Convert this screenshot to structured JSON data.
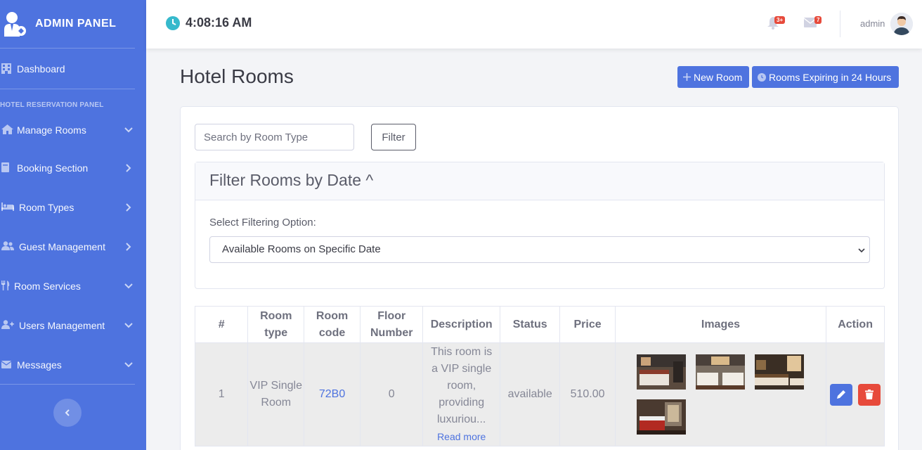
{
  "brand": {
    "title": "ADMIN PANEL"
  },
  "sidebar": {
    "dashboard": "Dashboard",
    "heading": "HOTEL RESERVATION PANEL",
    "items": [
      {
        "label": "Manage Rooms",
        "chevron": "down"
      },
      {
        "label": "Booking Section",
        "chevron": "right"
      },
      {
        "label": "Room Types",
        "chevron": "right"
      },
      {
        "label": "Guest Management",
        "chevron": "right"
      },
      {
        "label": "Room Services",
        "chevron": "down"
      },
      {
        "label": "Users Management",
        "chevron": "down"
      },
      {
        "label": "Messages",
        "chevron": "down"
      }
    ]
  },
  "topbar": {
    "time": "4:08:16 AM",
    "alerts_badge": "3+",
    "messages_badge": "7",
    "user": "admin"
  },
  "page": {
    "title": "Hotel Rooms",
    "new_room": "New Room",
    "expiring": "Rooms Expiring in 24 Hours"
  },
  "search": {
    "placeholder": "Search by Room Type",
    "filter_button": "Filter"
  },
  "date_filter": {
    "title": "Filter Rooms by Date ^",
    "label": "Select Filtering Option:",
    "selected": "Available Rooms on Specific Date"
  },
  "table": {
    "headers": [
      "#",
      "Room type",
      "Room code",
      "Floor Number",
      "Description",
      "Status",
      "Price",
      "Images",
      "Action"
    ],
    "rows": [
      {
        "num": "1",
        "type": "VIP Single Room",
        "code": "72B0",
        "floor": "0",
        "description": "This room is a VIP single room, providing luxuriou...",
        "read_more": "Read more",
        "status": "available",
        "price": "510.00"
      }
    ]
  },
  "colors": {
    "primary": "#4e73df",
    "danger": "#e74a3b",
    "clock": "#36b9cc"
  }
}
